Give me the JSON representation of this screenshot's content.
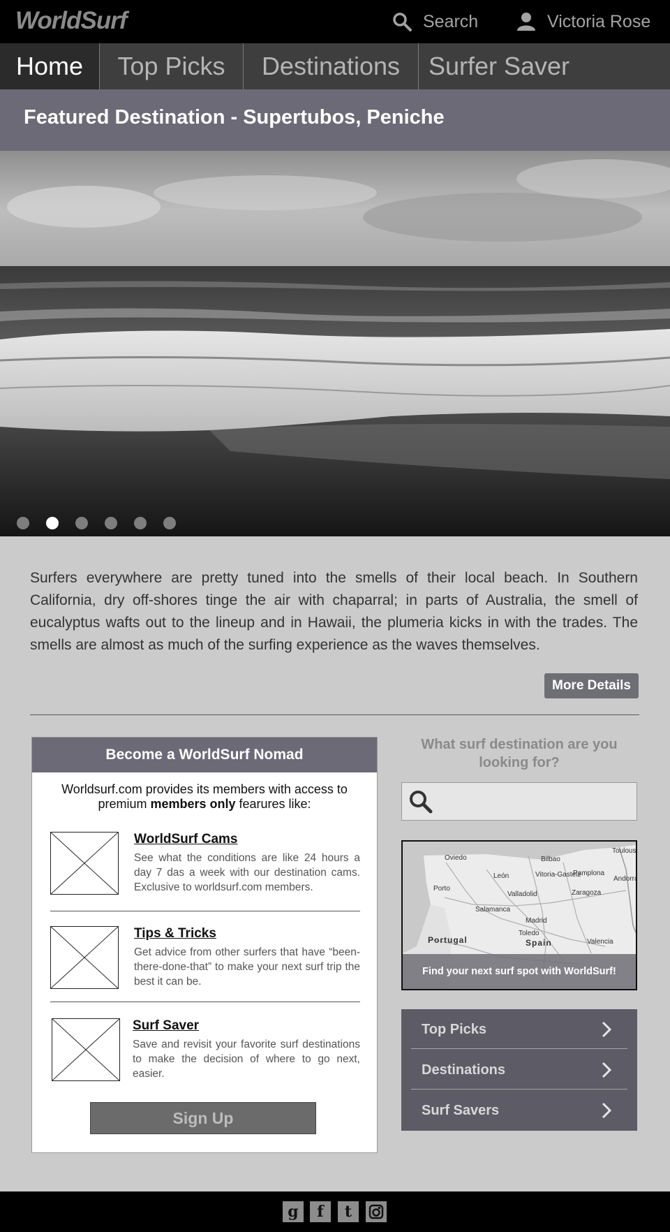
{
  "header": {
    "logo": "WorldSurf",
    "search_label": "Search",
    "user_name": "Victoria Rose"
  },
  "nav": {
    "tabs": [
      {
        "label": "Home",
        "active": true
      },
      {
        "label": "Top Picks",
        "active": false
      },
      {
        "label": "Destinations",
        "active": false
      },
      {
        "label": "Surfer Saver",
        "active": false
      }
    ]
  },
  "hero": {
    "title": "Featured Destination - Supertubos, Peniche",
    "slide_count": 6,
    "active_slide": 2
  },
  "intro": {
    "text": "Surfers everywhere are pretty tuned into the smells of their local beach. In Southern California, dry off-shores tinge the air with chaparral; in parts of Australia, the smell of eucalyptus wafts out to the lineup and in Hawaii, the plumeria kicks in with the trades. The smells are almost as much of the surfing experience as the waves themselves.",
    "more_button": "More Details"
  },
  "nomad": {
    "heading": "Become a WorldSurf Nomad",
    "intro_before": "Worldsurf.com provides its members with access to premium ",
    "intro_bold": "members only",
    "intro_after": " fearures like:",
    "features": [
      {
        "title": "WorldSurf Cams",
        "desc": "See what the conditions are like 24 hours a day 7 das a week with our destination cams. Exclusive to worldsurf.com members."
      },
      {
        "title": "Tips & Tricks",
        "desc": "Get advice from other surfers that have “been-there-done-that” to make your next surf trip the best it can be."
      },
      {
        "title": "Surf Saver",
        "desc": "Save and revisit your favorite surf destinations to make the decision of where to go next, easier."
      }
    ],
    "signup_button": "Sign Up"
  },
  "finder": {
    "question": "What surf destination are you looking for?",
    "search_placeholder": "",
    "map_caption": "Find your next surf spot with WorldSurf!",
    "map_labels": {
      "portugal": "Portugal",
      "spain": "Spain",
      "madrid": "Madrid",
      "zaragoza": "Zaragoza",
      "valladolid": "Valladolid",
      "bilbao": "Bilbao",
      "toledo": "Toledo",
      "valencia": "Valencia",
      "toulouse": "Toulouse",
      "andorra": "Andorra",
      "leon": "León",
      "oviedo": "Oviedo",
      "porto": "Porto",
      "salamanca": "Salamanca",
      "vitoria": "Vitoria-Gasteiz",
      "pamplona": "Pamplona"
    }
  },
  "quick_menu": {
    "items": [
      "Top Picks",
      "Destinations",
      "Surf Savers"
    ]
  },
  "footer": {
    "social": [
      {
        "icon": "google-plus-icon",
        "glyph": "g"
      },
      {
        "icon": "facebook-icon",
        "glyph": "f"
      },
      {
        "icon": "twitter-icon",
        "glyph": "t"
      },
      {
        "icon": "instagram-icon",
        "glyph": ""
      }
    ]
  },
  "colors": {
    "page_bg": "#cbcbcb",
    "topbar_bg": "#000000",
    "nav_bg": "#3e3e3e",
    "accent_panel": "#6c6a77",
    "menu_bg": "#5c5b66",
    "button_grey": "#6b6b6b"
  }
}
